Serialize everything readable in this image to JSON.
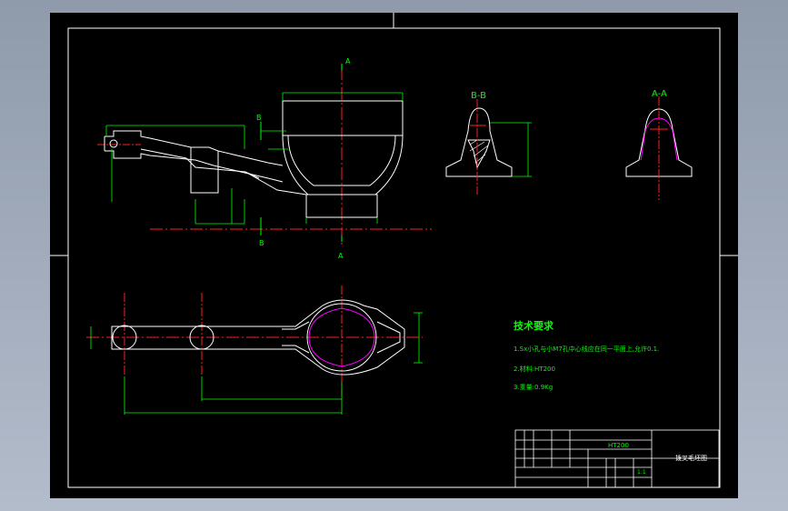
{
  "drawing": {
    "section_labels": {
      "bb": "B-B",
      "aa": "A-A"
    },
    "cut_marks": {
      "a_top": "A",
      "a_bottom": "A",
      "b_top": "B",
      "b_bottom": "B"
    },
    "tech_req": {
      "title": "技术要求",
      "item1": "1.Sx小孔与小M7孔中心线应在同一平面上,允许0.1.",
      "item2": "2.材料:HT200",
      "item3": "3.重量:0.9Kg"
    },
    "title_block": {
      "material": "HT200",
      "part_name": "拨叉毛坯图",
      "scale": "1:1"
    }
  },
  "colors": {
    "background": "#000000",
    "outline": "#ffffff",
    "dimension": "#00ff00",
    "centerline": "#ff2020",
    "hidden": "#ff00ff",
    "annotation": "#00ff00"
  }
}
